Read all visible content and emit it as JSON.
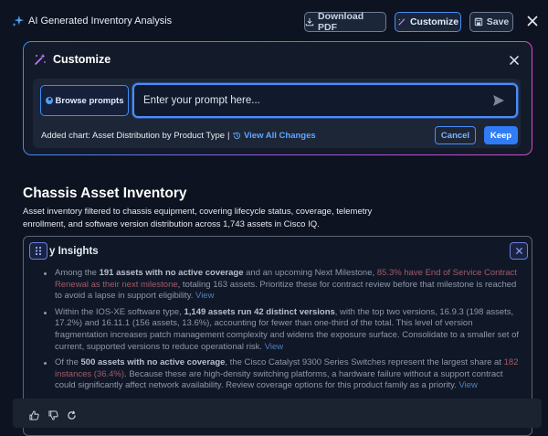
{
  "app": {
    "title": "AI Generated Inventory Analysis",
    "logo_icon": "sparkle-icon"
  },
  "toolbar": {
    "download_label": "Download PDF",
    "customize_label": "Customize",
    "save_label": "Save"
  },
  "customize": {
    "title": "Customize",
    "browse_label": "Browse prompts",
    "prompt_placeholder": "Enter your prompt here...",
    "prompt_value": "",
    "added_text": "Added chart: Asset Distribution by Product Type",
    "view_changes_label": "View All Changes",
    "cancel_label": "Cancel",
    "keep_label": "Keep"
  },
  "page": {
    "title": "Chassis Asset Inventory",
    "description": "Asset inventory filtered to chassis equipment, covering lifecycle status, coverage, telemetry enrollment, and software version distribution across 1,743 assets in Cisco IQ."
  },
  "insights": {
    "title": "y Insights",
    "items": [
      {
        "t1": "Among the ",
        "b1": "191 assets with no active coverage",
        "t2": " and an upcoming Next Milestone, ",
        "w1": "85.3% have End of Service Contract Renewal as their next milestone",
        "t3": ", totaling 163 assets. Prioritize these for contract review before that milestone is reached to avoid a lapse in support eligibility. ",
        "link": "View"
      },
      {
        "t1": "Within the IOS-XE software type, ",
        "b1": "1,149 assets run 42 distinct versions",
        "t2": ", with the top two versions, 16.9.3 (198 assets, 17.2%) and 16.11.1 (156 assets, 13.6%), accounting for fewer than one-third of the total. This level of version fragmentation increases patch management complexity and widens the exposure surface. Consolidate to a smaller set of current, supported versions to reduce operational risk. ",
        "link": "View"
      },
      {
        "t1": "Of the ",
        "b1": "500 assets with no active coverage",
        "t2": ", the Cisco Catalyst 9300 Series Switches represent the largest share at ",
        "w1": "182 instances (36.4%)",
        "t3": ". Because these are high-density switching platforms, a hardware failure without a support contract could significantly affect network availability. Review coverage options for this product family as a priority. ",
        "link": "View"
      }
    ]
  },
  "feedback": {
    "icons": [
      "thumbs-up-icon",
      "thumbs-down-icon",
      "refresh-icon"
    ]
  },
  "colors": {
    "accent": "#4b8df8",
    "warning_text": "#a35a66",
    "background": "#0d1320"
  }
}
